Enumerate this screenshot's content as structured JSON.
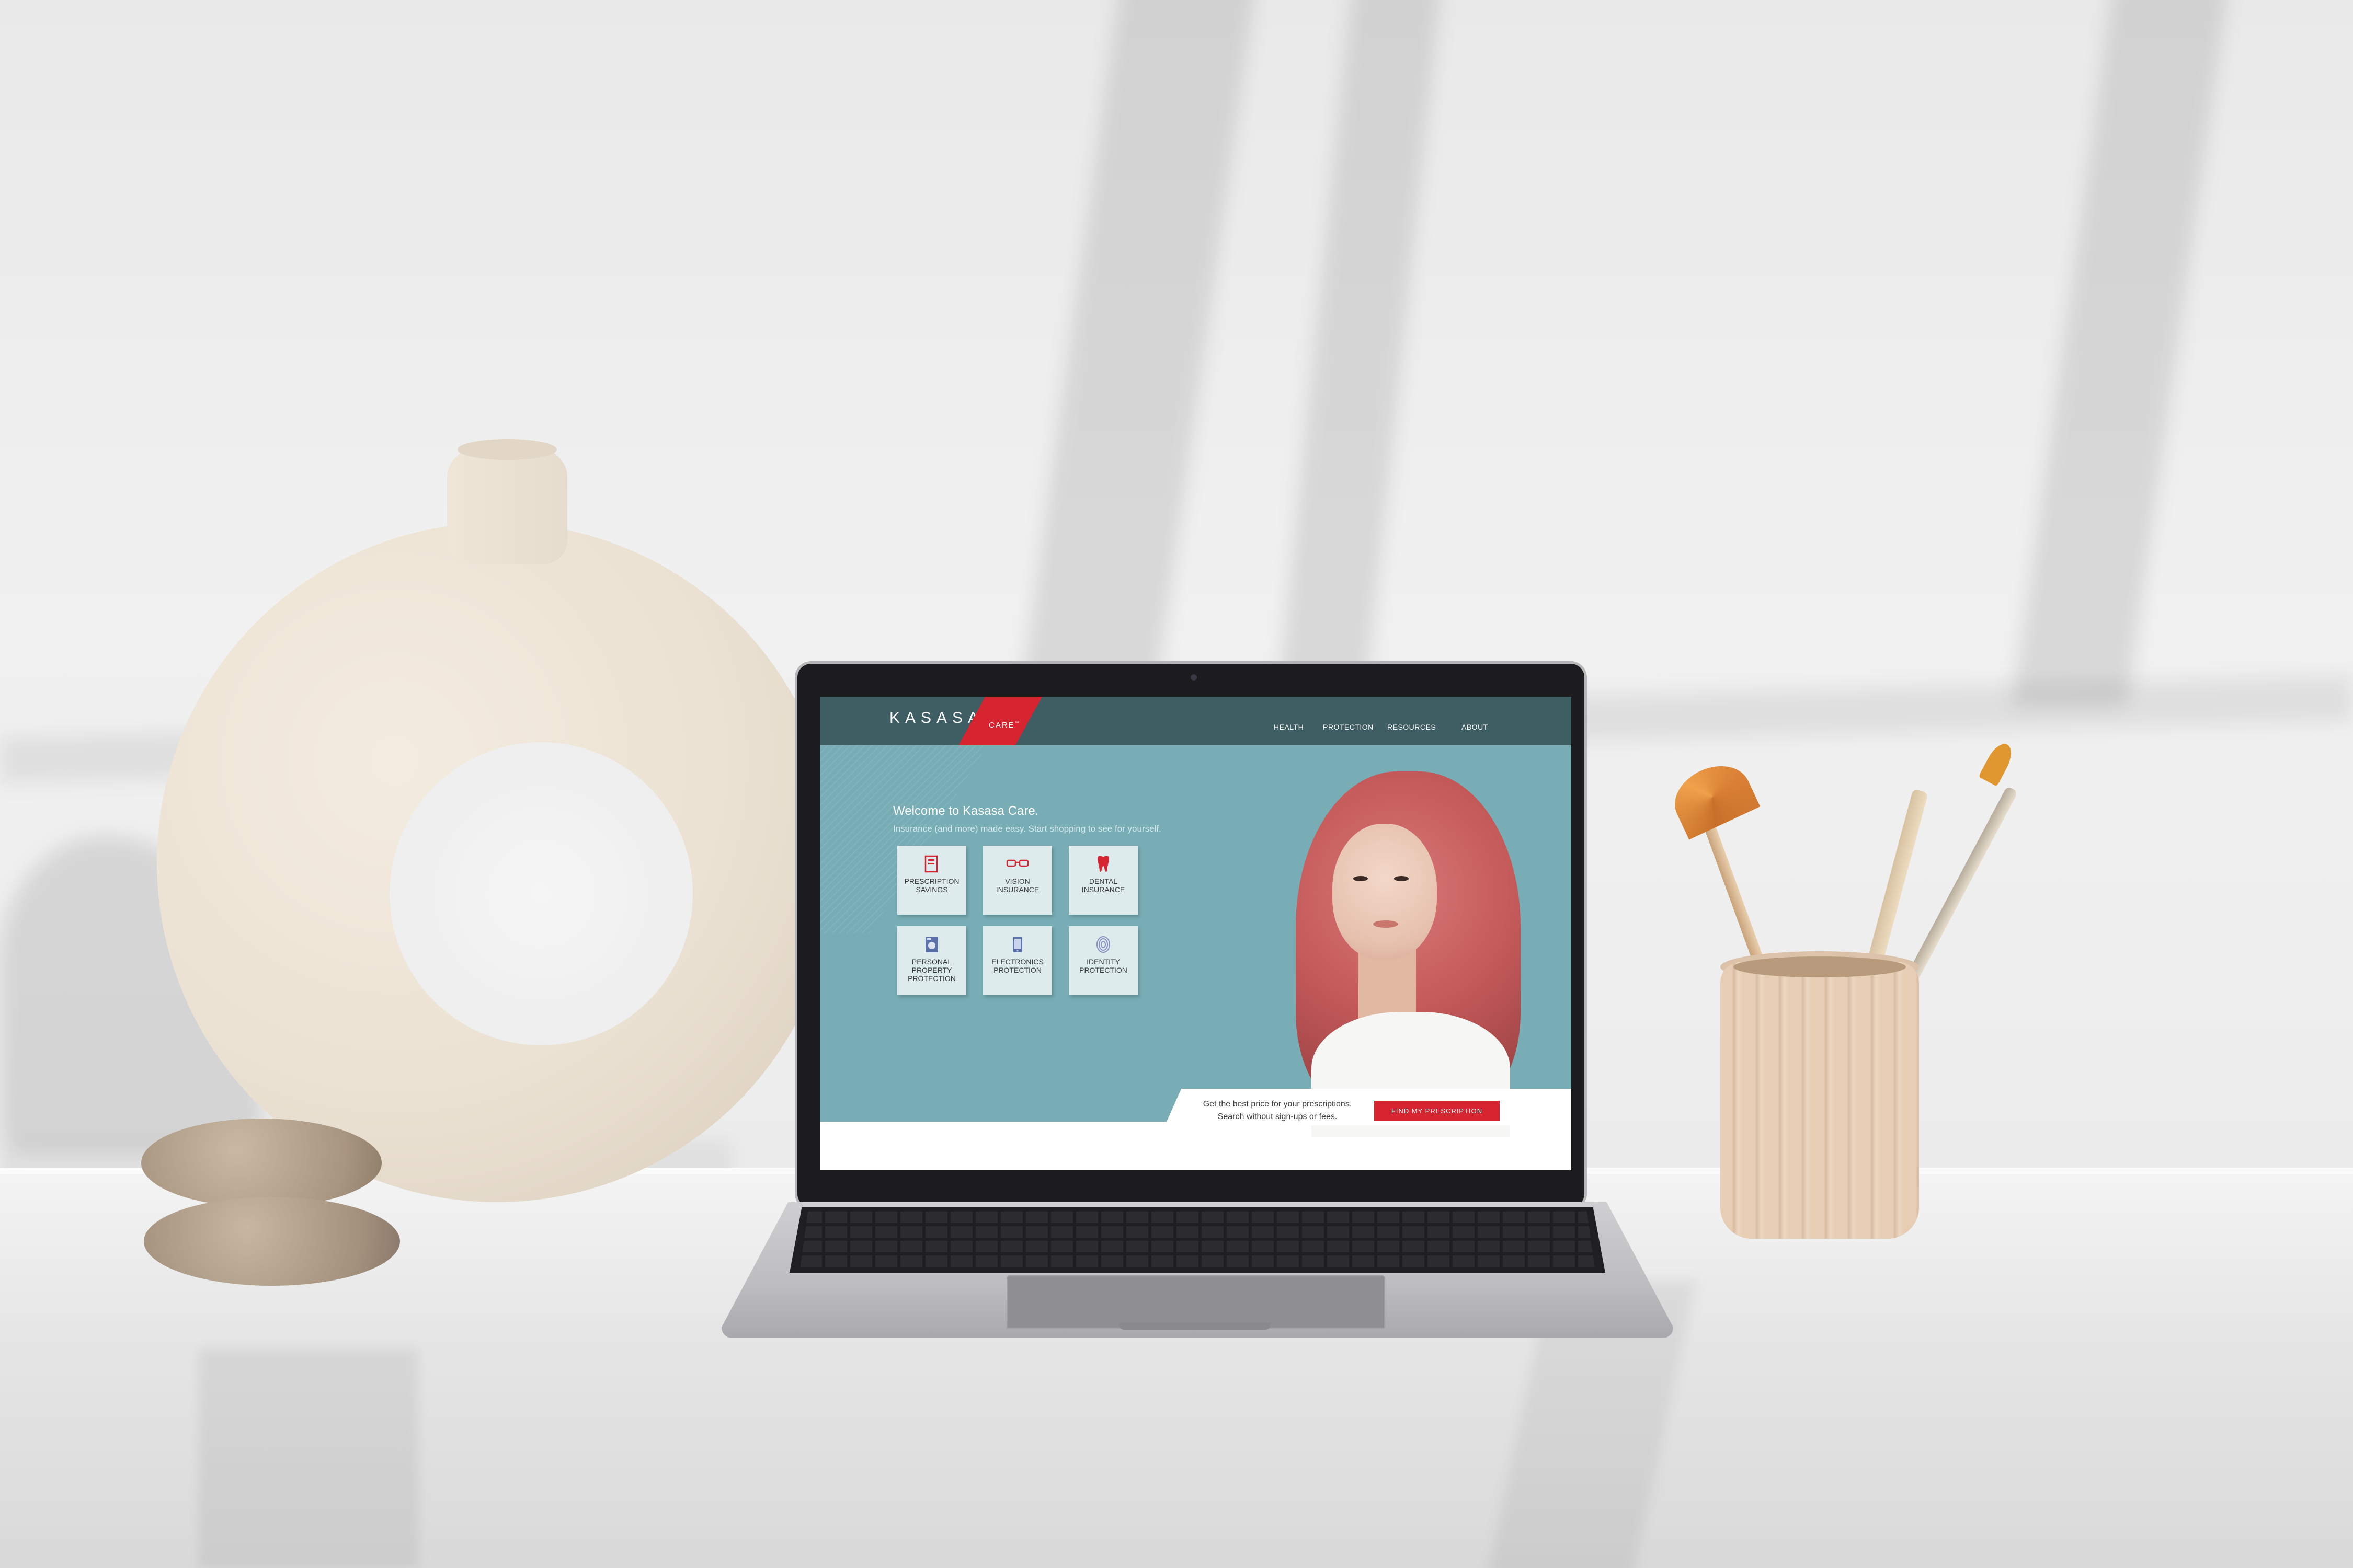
{
  "brand": {
    "name": "KASASA",
    "sub": "CARE",
    "sub_mark": "™",
    "colors": {
      "nav": "#3f5e63",
      "accent": "#d62430",
      "hero": "#78adb5",
      "tile": "#ddebed"
    }
  },
  "nav": {
    "items": [
      {
        "label": "HEALTH"
      },
      {
        "label": "PROTECTION"
      },
      {
        "label": "RESOURCES"
      },
      {
        "label": "ABOUT"
      }
    ]
  },
  "hero": {
    "title": "Welcome to Kasasa Care.",
    "subtitle": "Insurance (and more) made easy. Start shopping to see for yourself."
  },
  "tiles": [
    {
      "label": "PRESCRIPTION SAVINGS",
      "icon": "prescription-icon"
    },
    {
      "label": "VISION INSURANCE",
      "icon": "glasses-icon"
    },
    {
      "label": "DENTAL INSURANCE",
      "icon": "tooth-icon"
    },
    {
      "label": "PERSONAL PROPERTY PROTECTION",
      "icon": "washer-icon"
    },
    {
      "label": "ELECTRONICS PROTECTION",
      "icon": "phone-icon"
    },
    {
      "label": "IDENTITY PROTECTION",
      "icon": "fingerprint-icon"
    }
  ],
  "cta": {
    "line1": "Get the best price for your prescriptions.",
    "line2": "Search without sign-ups or fees.",
    "button": "FIND MY PRESCRIPTION"
  }
}
